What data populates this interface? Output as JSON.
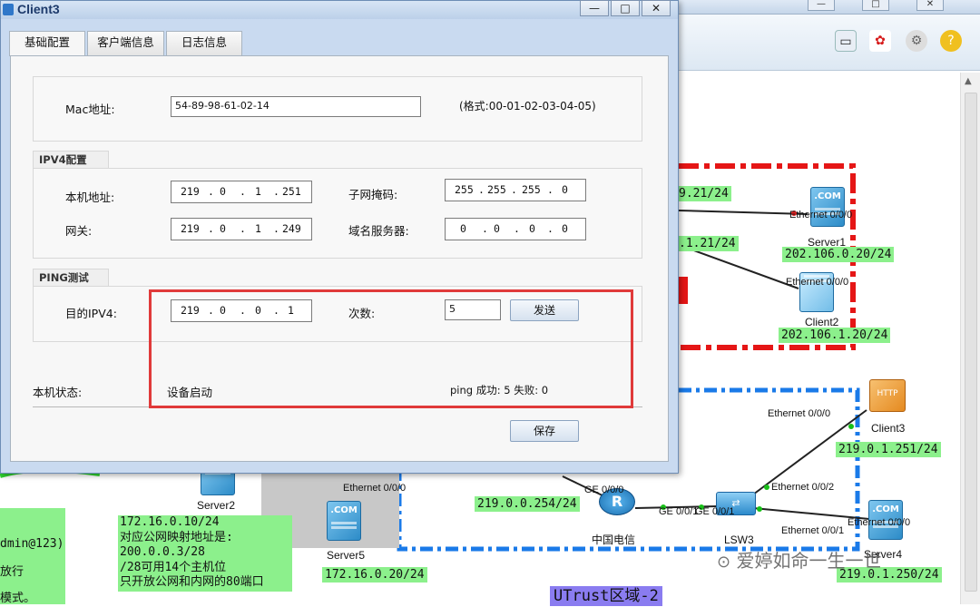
{
  "background": {
    "window_buttons": [
      "—",
      "□",
      "✕"
    ],
    "left_partial_lines": [
      "dmin@123)",
      "放行",
      "模式。"
    ],
    "server2_label": "Server2",
    "server5_label": "Server5",
    "server5_port": "Ethernet 0/0/0",
    "server5_ip": "172.16.0.20/24",
    "mapping_note": [
      "172.16.0.10/24",
      "对应公网映射地址是:",
      "200.0.0.3/28",
      "/28可用14个主机位",
      "只开放公网和内网的80端口"
    ],
    "partial_ip_1": "9.21/24",
    "partial_ip_2": ".1.21/24",
    "server1": {
      "label": "Server1",
      "port": "Ethernet 0/0/0",
      "ip": "202.106.0.20/24"
    },
    "client2": {
      "label": "Client2",
      "port": "Ethernet 0/0/0",
      "ip": "202.106.1.20/24"
    },
    "client3": {
      "label": "Client3",
      "port": "Ethernet 0/0/0",
      "ip": "219.0.1.251/24",
      "icon_text": "HTTP"
    },
    "router": {
      "label": "中国电信",
      "port_left": "GE 0/0/0",
      "port_right": "GE 0/0/1",
      "ip": "219.0.0.254/24"
    },
    "lsw3": {
      "label": "LSW3",
      "port_left": "GE 0/0/1",
      "port_p2": "Ethernet 0/0/2",
      "port_p1": "Ethernet 0/0/1"
    },
    "server4": {
      "label": "Server4",
      "port": "Ethernet 0/0/0",
      "ip": "219.0.1.250/24"
    },
    "zone_label": "UTrust区域-2",
    "watermark": "爱婷如命一生一世",
    "icon_com": ".COM"
  },
  "dialog": {
    "title": "Client3",
    "tabs": [
      "基础配置",
      "客户端信息",
      "日志信息"
    ],
    "active_tab": 0,
    "mac_label": "Mac地址:",
    "mac_value": "54-89-98-61-02-14",
    "mac_hint": "(格式:00-01-02-03-04-05)",
    "ipv4_group_title": "IPV4配置",
    "local_ip_label": "本机地址:",
    "local_ip": [
      "219",
      "0",
      "1",
      "251"
    ],
    "subnet_label": "子网掩码:",
    "subnet": [
      "255",
      "255",
      "255",
      "0"
    ],
    "gateway_label": "网关:",
    "gateway": [
      "219",
      "0",
      "1",
      "249"
    ],
    "dns_label": "域名服务器:",
    "dns": [
      "0",
      "0",
      "0",
      "0"
    ],
    "ping_group_title": "PING测试",
    "dest_label": "目的IPV4:",
    "dest_ip": [
      "219",
      "0",
      "0",
      "1"
    ],
    "count_label": "次数:",
    "count_value": "5",
    "send_button": "发送",
    "status_label": "本机状态:",
    "status_value": "设备启动",
    "ping_result": "ping 成功: 5   失败: 0",
    "save_button": "保存",
    "highlight_color": "#e03a3a"
  }
}
